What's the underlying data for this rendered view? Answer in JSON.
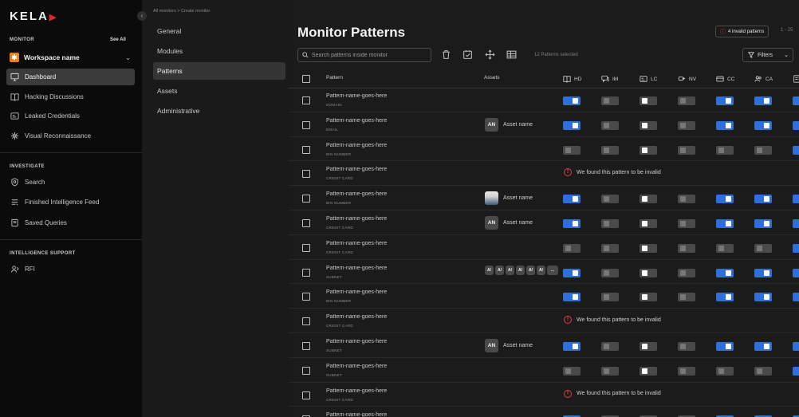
{
  "app": {
    "logo": "KELA"
  },
  "sidebar": {
    "monitor_title": "MONITOR",
    "see_all": "See All",
    "workspace": "Workspace name",
    "monitor_items": [
      {
        "label": "Dashboard",
        "icon": "monitor-icon",
        "active": true
      },
      {
        "label": "Hacking Discussions",
        "icon": "book-icon"
      },
      {
        "label": "Leaked Credentials",
        "icon": "key-card-icon"
      },
      {
        "label": "Visual Reconnaissance",
        "icon": "network-icon"
      }
    ],
    "investigate_title": "INVESTIGATE",
    "investigate_items": [
      {
        "label": "Search",
        "icon": "shield-search-icon"
      },
      {
        "label": "Finished Intelligence Feed",
        "icon": "feed-icon"
      },
      {
        "label": "Saved Queries",
        "icon": "bookmark-icon"
      }
    ],
    "support_title": "INTELLIGENCE SUPPORT",
    "support_items": [
      {
        "label": "RFI",
        "icon": "user-request-icon"
      }
    ]
  },
  "subnav": {
    "breadcrumb": "All monitors  >  Create monitor",
    "items": [
      "General",
      "Modules",
      "Patterns",
      "Assets",
      "Administrative"
    ],
    "active": "Patterns"
  },
  "main": {
    "title": "Monitor Patterns",
    "invalid_badge": "4 invalid patterns",
    "range": "1 - 25",
    "search_placeholder": "Search patterns inside monitor",
    "selected_count": "12 Patterns selected",
    "filters_label": "Filters",
    "columns": {
      "pattern": "Pattern",
      "assets": "Assets"
    },
    "modules": [
      {
        "code": "HD",
        "icon": "book-icon"
      },
      {
        "code": "IM",
        "icon": "chat-icon"
      },
      {
        "code": "LC",
        "icon": "key-card-icon"
      },
      {
        "code": "NV",
        "icon": "network-icon"
      },
      {
        "code": "CC",
        "icon": "credit-card-icon"
      },
      {
        "code": "CA",
        "icon": "users-icon"
      },
      {
        "code": "",
        "icon": "doc-icon"
      }
    ],
    "invalid_message": "We found this pattern to be invalid",
    "rows": [
      {
        "name": "Pattern-name-goes-here",
        "type": "DOMAIN",
        "asset": null,
        "toggles": [
          "on",
          "off",
          "white",
          "off",
          "on",
          "on",
          "on"
        ]
      },
      {
        "name": "Pattern-name-goes-here",
        "type": "EMAIL",
        "asset": {
          "kind": "initials",
          "initials": "AN",
          "name": "Asset name"
        },
        "toggles": [
          "on",
          "off",
          "white",
          "off",
          "on",
          "on",
          "on"
        ]
      },
      {
        "name": "Pattern-name-goes-here",
        "type": "BIN NUMBER",
        "asset": null,
        "toggles": [
          "off",
          "off",
          "white",
          "off",
          "off",
          "off",
          "on"
        ]
      },
      {
        "name": "Pattern-name-goes-here",
        "type": "CREDIT CARD",
        "invalid": true
      },
      {
        "name": "Pattern-name-goes-here",
        "type": "BIN NUMBER",
        "asset": {
          "kind": "photo",
          "name": "Asset name"
        },
        "toggles": [
          "on",
          "off",
          "white",
          "off",
          "on",
          "on",
          "on"
        ]
      },
      {
        "name": "Pattern-name-goes-here",
        "type": "CREDIT CARD",
        "asset": {
          "kind": "initials",
          "initials": "AN",
          "name": "Asset name"
        },
        "toggles": [
          "on",
          "off",
          "white",
          "off",
          "on",
          "on",
          "on"
        ]
      },
      {
        "name": "Pattern-name-goes-here",
        "type": "CREDIT CARD",
        "asset": null,
        "toggles": [
          "off",
          "off",
          "white",
          "off",
          "off",
          "off",
          "on"
        ]
      },
      {
        "name": "Pattern-name-goes-here",
        "type": "SUBNET",
        "asset": {
          "kind": "group",
          "initials": [
            "A/",
            "A/",
            "A/",
            "A/",
            "A/",
            "A/"
          ],
          "more": "..."
        },
        "toggles": [
          "on",
          "off",
          "white",
          "off",
          "on",
          "on",
          "on"
        ]
      },
      {
        "name": "Pattern-name-goes-here",
        "type": "BIN NUMBER",
        "asset": null,
        "toggles": [
          "on",
          "off",
          "white",
          "off",
          "on",
          "on",
          "on"
        ]
      },
      {
        "name": "Pattern-name-goes-here",
        "type": "CREDIT CARD",
        "invalid": true
      },
      {
        "name": "Pattern-name-goes-here",
        "type": "SUBNET",
        "asset": {
          "kind": "initials",
          "initials": "AN",
          "name": "Asset name"
        },
        "toggles": [
          "on",
          "off",
          "white",
          "off",
          "on",
          "on",
          "on"
        ]
      },
      {
        "name": "Pattern-name-goes-here",
        "type": "SUBNET",
        "asset": null,
        "toggles": [
          "off",
          "off",
          "white",
          "off",
          "off",
          "off",
          "on"
        ]
      },
      {
        "name": "Pattern-name-goes-here",
        "type": "CREDIT CARD",
        "invalid": true
      },
      {
        "name": "Pattern-name-goes-here",
        "type": "CREDIT CARD",
        "asset": null,
        "toggles": [
          "on",
          "off",
          "white",
          "off",
          "on",
          "on",
          "on"
        ]
      }
    ]
  }
}
